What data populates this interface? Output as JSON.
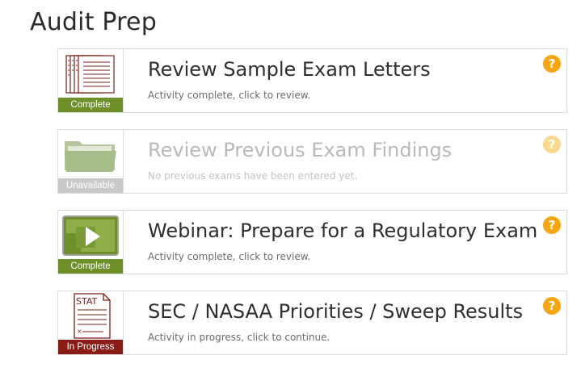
{
  "page": {
    "title": "Audit Prep"
  },
  "activities": [
    {
      "title": "Review Sample Exam Letters",
      "subtitle": "Activity complete, click to review.",
      "status": "Complete",
      "icon": "documents-icon",
      "help": "?"
    },
    {
      "title": "Review Previous Exam Findings",
      "subtitle": "No previous exams have been entered yet.",
      "status": "Unavailable",
      "icon": "folder-icon",
      "help": "?"
    },
    {
      "title": "Webinar: Prepare for a Regulatory Exam",
      "subtitle": "Activity complete, click to review.",
      "status": "Complete",
      "icon": "video-play-icon",
      "help": "?"
    },
    {
      "title": "SEC / NASAA Priorities / Sweep Results",
      "subtitle": "Activity in progress, click to continue.",
      "status": "In Progress",
      "icon": "stat-document-icon",
      "icon_text": "STAT",
      "help": "?"
    }
  ],
  "colors": {
    "complete": "#6f8f2a",
    "unavailable": "#c9c9c9",
    "in_progress": "#8b1b16",
    "help": "#f7a613"
  }
}
